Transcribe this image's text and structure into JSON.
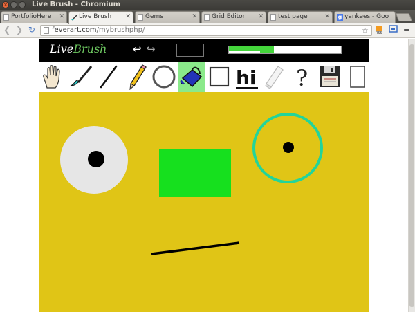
{
  "window": {
    "title": "Live Brush - Chromium"
  },
  "tabs": [
    {
      "label": "PortfolioHere",
      "icon": "page-icon"
    },
    {
      "label": "Live Brush",
      "icon": "brush-favicon",
      "active": true
    },
    {
      "label": "Gems",
      "icon": "page-icon"
    },
    {
      "label": "Grid Editor",
      "icon": "page-icon"
    },
    {
      "label": "test page",
      "icon": "page-icon"
    },
    {
      "label": "yankees - Goo",
      "icon": "google-favicon"
    }
  ],
  "omnibox": {
    "domain": "feverart.com",
    "path": "/mybrushphp/"
  },
  "app": {
    "brand_live": "Live",
    "brand_brush": "Brush",
    "undo_icon": "undo-icon",
    "redo_icon": "redo-icon",
    "current_color": "#000000",
    "brush_size_fraction": 0.4,
    "size_fill_color": "#44d53b"
  },
  "tools": [
    {
      "name": "hand",
      "icon": "hand-icon"
    },
    {
      "name": "brush",
      "icon": "paintbrush-icon"
    },
    {
      "name": "line",
      "icon": "line-icon"
    },
    {
      "name": "pencil",
      "icon": "pencil-icon"
    },
    {
      "name": "circle",
      "icon": "circle-icon"
    },
    {
      "name": "fill",
      "icon": "paint-bucket-icon",
      "active": true
    },
    {
      "name": "rectangle",
      "icon": "rectangle-icon"
    },
    {
      "name": "text",
      "icon": "text-icon",
      "label": "hi"
    },
    {
      "name": "eraser",
      "icon": "eraser-icon"
    },
    {
      "name": "help",
      "icon": "help-icon",
      "label": "?"
    },
    {
      "name": "save",
      "icon": "floppy-disk-icon"
    },
    {
      "name": "new-page",
      "icon": "new-page-icon"
    }
  ],
  "canvas": {
    "background": "#e0c516",
    "accent_green": "#16e01e",
    "ring_teal": "#23d49a",
    "eye_white": "#e6e6e6"
  }
}
